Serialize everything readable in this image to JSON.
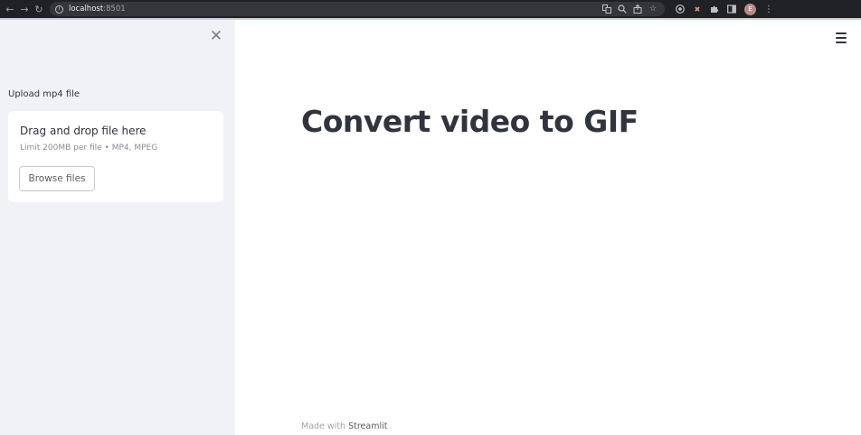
{
  "browser": {
    "url_host": "localhost",
    "url_port": ":8501",
    "avatar_initial": "E",
    "icons": {
      "back": "back-arrow-icon",
      "forward": "forward-arrow-icon",
      "reload": "reload-icon",
      "site_info": "info-icon",
      "translate": "translate-icon",
      "zoom": "zoom-icon",
      "share": "share-icon",
      "bookmark": "star-icon",
      "extension1": "extension-icon",
      "extension2": "extension-icon",
      "puzzle": "puzzle-icon",
      "sidepanel": "side-panel-icon",
      "menu": "kebab-menu-icon"
    }
  },
  "sidebar": {
    "upload_label": "Upload mp4 file",
    "dropzone": {
      "title": "Drag and drop file here",
      "subtitle": "Limit 200MB per file • MP4, MPEG",
      "browse_label": "Browse files"
    }
  },
  "main": {
    "title": "Convert video to GIF",
    "footer_prefix": "Made with ",
    "footer_brand": "Streamlit"
  },
  "colors": {
    "chrome_bg": "#202124",
    "sidebar_bg": "#f0f2f6",
    "text": "#31333f"
  }
}
